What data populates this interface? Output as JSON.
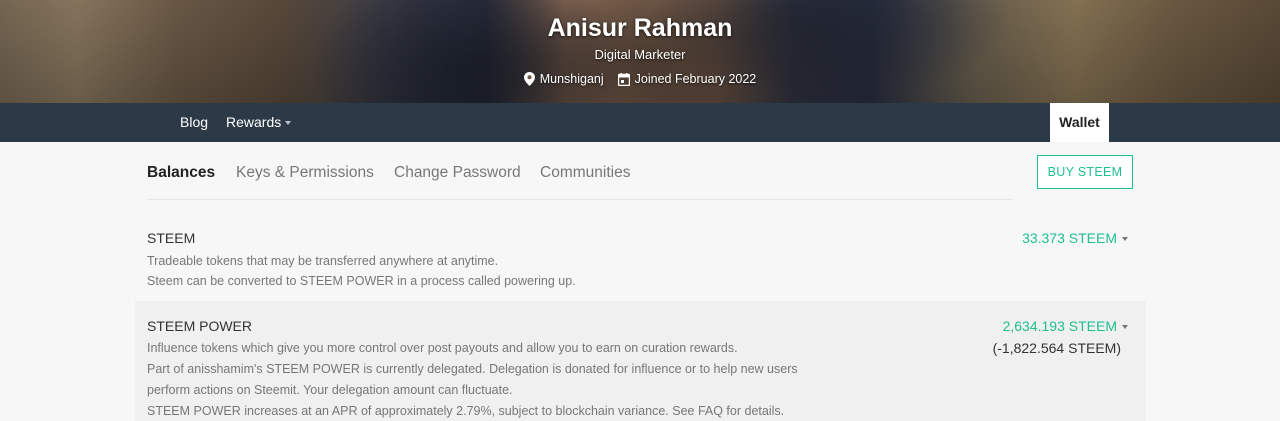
{
  "profile": {
    "name": "Anisur Rahman",
    "about": "Digital Marketer",
    "location": "Munshiganj",
    "joined": "Joined February 2022",
    "location_icon": "map-pin-icon",
    "calendar_icon": "calendar-icon"
  },
  "nav": {
    "blog": "Blog",
    "rewards": "Rewards",
    "wallet": "Wallet"
  },
  "subnav": {
    "balances": "Balances",
    "keys": "Keys & Permissions",
    "password": "Change Password",
    "communities": "Communities"
  },
  "buy_button": "BUY STEEM",
  "balances": {
    "steem": {
      "title": "STEEM",
      "desc1": "Tradeable tokens that may be transferred anywhere at anytime.",
      "desc2": "Steem can be converted to STEEM POWER in a process called powering up.",
      "amount": "33.373 STEEM"
    },
    "steem_power": {
      "title": "STEEM POWER",
      "desc1": "Influence tokens which give you more control over post payouts and allow you to earn on curation rewards.",
      "desc2": "Part of anisshamim's STEEM POWER is currently delegated. Delegation is donated for influence or to help new users",
      "desc3": "perform actions on Steemit. Your delegation amount can fluctuate.",
      "desc4": "STEEM POWER increases at an APR of approximately 2.79%, subject to blockchain variance. See FAQ for details.",
      "amount": "2,634.193 STEEM",
      "delegated": "(-1,822.564 STEEM)"
    }
  },
  "colors": {
    "accent": "#1fbf8f",
    "navbar": "#2c3a47"
  }
}
